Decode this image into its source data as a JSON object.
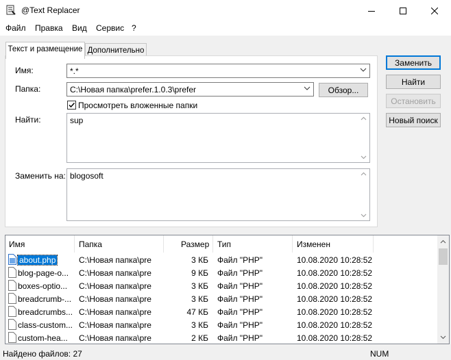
{
  "window": {
    "title": "@Text Replacer",
    "minimize_icon": "minimize-icon",
    "maximize_icon": "maximize-icon",
    "close_icon": "close-icon"
  },
  "menu": [
    "Файл",
    "Правка",
    "Вид",
    "Сервис",
    "?"
  ],
  "tabs": [
    {
      "label": "Текст и размещение",
      "active": true
    },
    {
      "label": "Дополнительно",
      "active": false
    }
  ],
  "form": {
    "name_label": "Имя:",
    "name_value": "*.*",
    "folder_label": "Папка:",
    "folder_value": "C:\\Новая папка\\prefer.1.0.3\\prefer",
    "browse_label": "Обзор...",
    "subfolders_label": "Просмотреть вложенные папки",
    "subfolders_checked": true,
    "find_label": "Найти:",
    "find_value": "sup",
    "replace_label": "Заменить на:",
    "replace_value": "blogosoft"
  },
  "actions": {
    "replace": "Заменить",
    "find": "Найти",
    "stop": "Остановить",
    "new_search": "Новый поиск"
  },
  "results": {
    "columns": [
      "Имя",
      "Папка",
      "Размер",
      "Тип",
      "Изменен"
    ],
    "rows": [
      {
        "name": "about.php",
        "folder": "C:\\Новая папка\\pre",
        "size": "3 КБ",
        "type": "Файл \"PHP\"",
        "modified": "10.08.2020 10:28:52",
        "selected": true
      },
      {
        "name": "blog-page-o...",
        "folder": "C:\\Новая папка\\pre",
        "size": "9 КБ",
        "type": "Файл \"PHP\"",
        "modified": "10.08.2020 10:28:52"
      },
      {
        "name": "boxes-optio...",
        "folder": "C:\\Новая папка\\pre",
        "size": "3 КБ",
        "type": "Файл \"PHP\"",
        "modified": "10.08.2020 10:28:52"
      },
      {
        "name": "breadcrumb-...",
        "folder": "C:\\Новая папка\\pre",
        "size": "3 КБ",
        "type": "Файл \"PHP\"",
        "modified": "10.08.2020 10:28:52"
      },
      {
        "name": "breadcrumbs...",
        "folder": "C:\\Новая папка\\pre",
        "size": "47 КБ",
        "type": "Файл \"PHP\"",
        "modified": "10.08.2020 10:28:52"
      },
      {
        "name": "class-custom...",
        "folder": "C:\\Новая папка\\pre",
        "size": "3 КБ",
        "type": "Файл \"PHP\"",
        "modified": "10.08.2020 10:28:52"
      },
      {
        "name": "custom-hea...",
        "folder": "C:\\Новая папка\\pre",
        "size": "2 КБ",
        "type": "Файл \"PHP\"",
        "modified": "10.08.2020 10:28:52"
      }
    ]
  },
  "status": {
    "found": "Найдено файлов: 27",
    "num": "NUM"
  }
}
